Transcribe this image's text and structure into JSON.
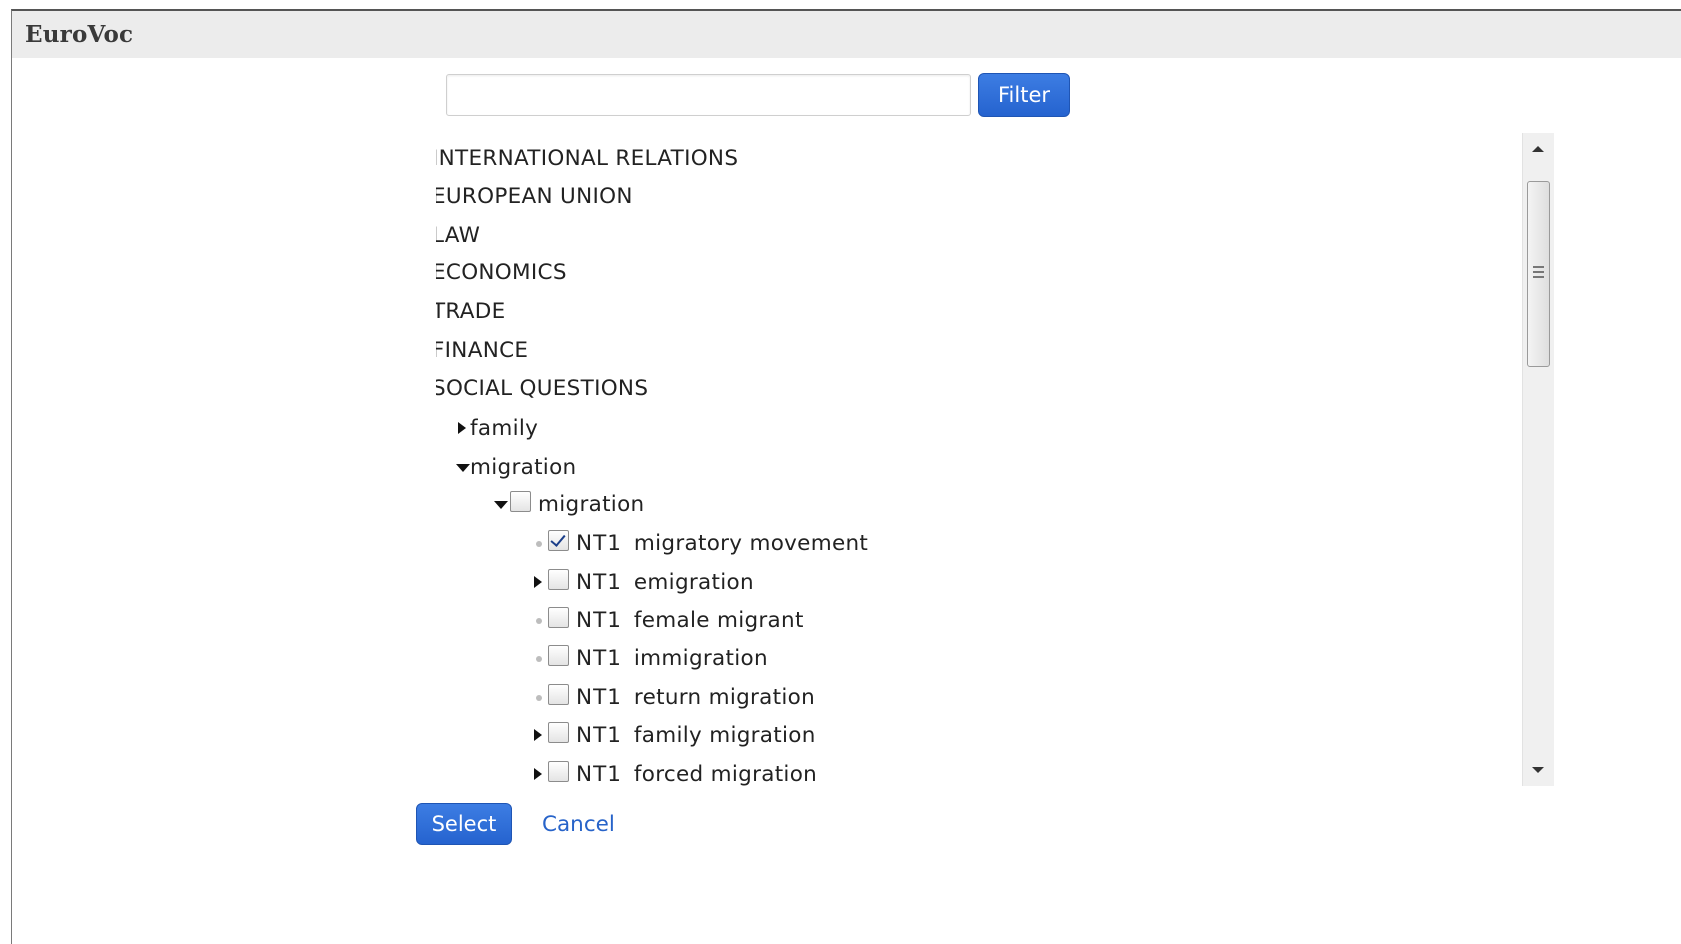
{
  "dialog": {
    "title": "EuroVoc"
  },
  "filter": {
    "input_value": "",
    "placeholder": "",
    "button_label": "Filter"
  },
  "tree": {
    "top_level": [
      {
        "label": "INTERNATIONAL RELATIONS",
        "expanded": false
      },
      {
        "label": "EUROPEAN UNION",
        "expanded": false
      },
      {
        "label": "LAW",
        "expanded": false
      },
      {
        "label": "ECONOMICS",
        "expanded": false
      },
      {
        "label": "TRADE",
        "expanded": false
      },
      {
        "label": "FINANCE",
        "expanded": false
      },
      {
        "label": "SOCIAL QUESTIONS",
        "expanded": true
      }
    ],
    "social_children": [
      {
        "label": "family",
        "expanded": false
      },
      {
        "label": "migration",
        "expanded": true
      }
    ],
    "migration_term": {
      "label": "migration",
      "expanded": true,
      "checked": false
    },
    "narrower_prefix": "NT1",
    "narrower_terms": [
      {
        "label": "migratory movement",
        "checked": true,
        "has_children": false
      },
      {
        "label": "emigration",
        "checked": false,
        "has_children": true
      },
      {
        "label": "female migrant",
        "checked": false,
        "has_children": false
      },
      {
        "label": "immigration",
        "checked": false,
        "has_children": false
      },
      {
        "label": "return migration",
        "checked": false,
        "has_children": false
      },
      {
        "label": "family migration",
        "checked": false,
        "has_children": true
      },
      {
        "label": "forced migration",
        "checked": false,
        "has_children": true
      }
    ]
  },
  "footer": {
    "select_label": "Select",
    "cancel_label": "Cancel"
  },
  "colors": {
    "primary_button": "#2f6fd9",
    "link": "#2763c9",
    "titlebar_bg": "#ececec"
  },
  "icons": {
    "collapsed": "triangle-right-icon",
    "expanded": "triangle-down-icon",
    "leaf": "bullet-dot-icon",
    "checkbox": "checkbox-icon"
  }
}
